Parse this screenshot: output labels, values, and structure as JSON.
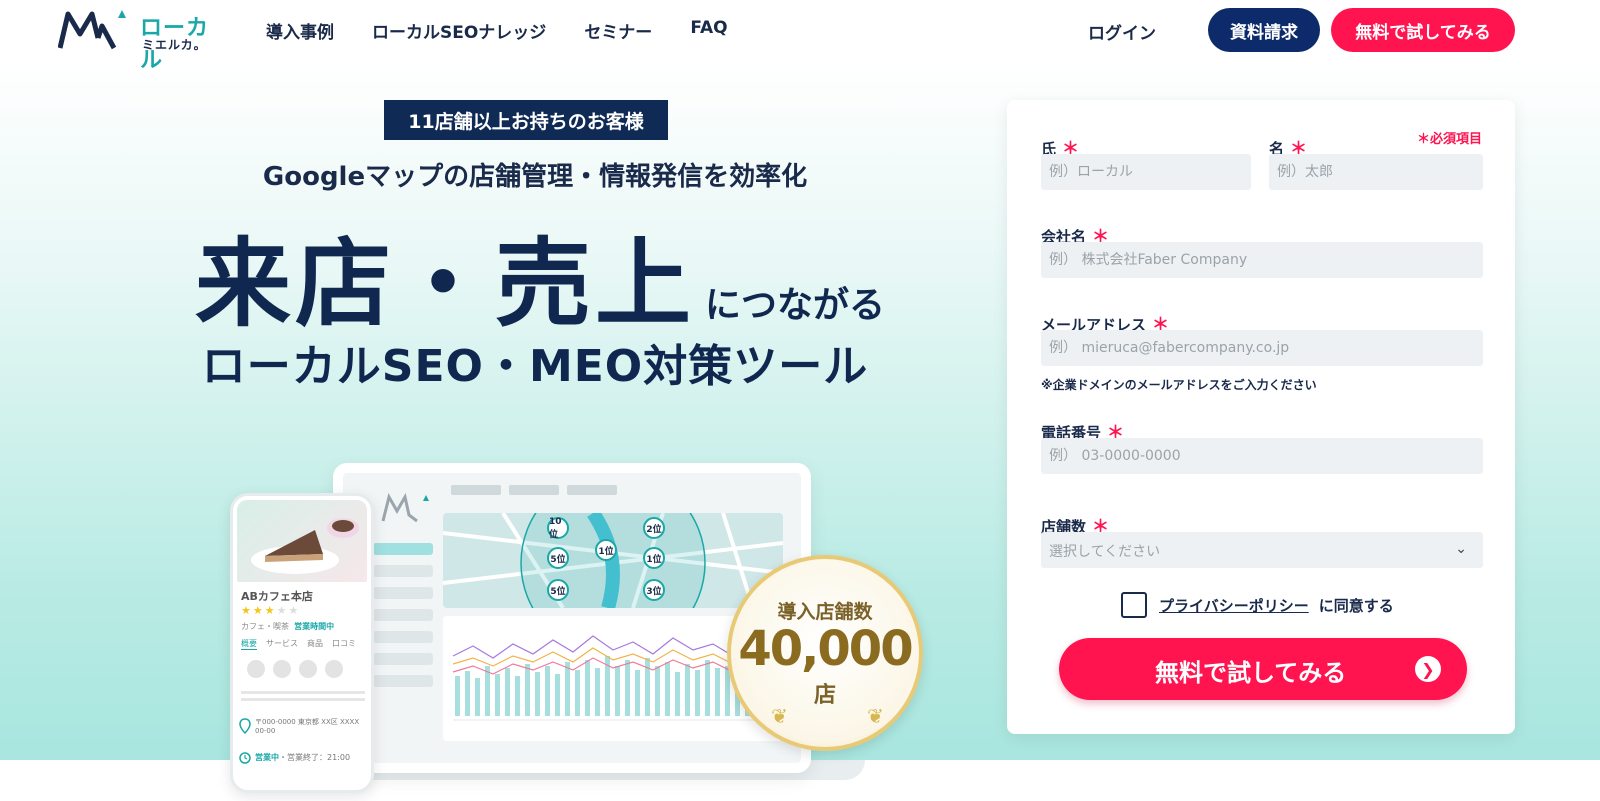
{
  "header": {
    "logo_top": "ローカル",
    "logo_bottom": "ミエルカ。",
    "nav": [
      "導入事例",
      "ローカルSEOナレッジ",
      "セミナー",
      "FAQ"
    ],
    "login": "ログイン",
    "docs_button": "資料請求",
    "trial_button": "無料で試してみる"
  },
  "hero": {
    "tag": "11店舗以上お持ちのお客様",
    "subtitle": "Googleマップの店舗管理・情報発信を効率化",
    "headline_big": "来店・売上",
    "headline_small": "につながる",
    "tagline": "ローカルSEO・MEO対策ツール",
    "badge": {
      "top": "導入店舗数",
      "number": "40,000",
      "unit": "店"
    },
    "phone": {
      "shop_name": "ABカフェ本店",
      "category": "カフェ・喫茶",
      "status": "営業時間中",
      "tabs": [
        "概要",
        "サービス",
        "商品",
        "口コミ"
      ],
      "address": "〒000-0000 東京都 XX区 XXXX 00-00",
      "hours_open": "営業中",
      "hours_close": "・営業終了：21:00"
    },
    "map_pins": [
      "10位",
      "2位",
      "5位",
      "1位",
      "1位",
      "5位",
      "3位"
    ]
  },
  "form": {
    "required_note": "＊必須項目",
    "last_name": {
      "label": "氏",
      "placeholder": "例）ローカル"
    },
    "first_name": {
      "label": "名",
      "placeholder": "例）太郎"
    },
    "company": {
      "label": "会社名",
      "placeholder": "例） 株式会社Faber Company"
    },
    "email": {
      "label": "メールアドレス",
      "placeholder": "例） mieruca@fabercompany.co.jp"
    },
    "email_note": "※企業ドメインのメールアドレスをご入力ください",
    "phone": {
      "label": "電話番号",
      "placeholder": "例） 03-0000-0000"
    },
    "stores": {
      "label": "店舗数",
      "value": "選択してください"
    },
    "required_mark": "＊",
    "policy_link": "プライバシーポリシー",
    "agree_text": "に同意する",
    "submit": "無料で試してみる"
  },
  "colors": {
    "navy": "#0d2a6b",
    "accent": "#ff1450",
    "teal": "#1aa7a7"
  }
}
